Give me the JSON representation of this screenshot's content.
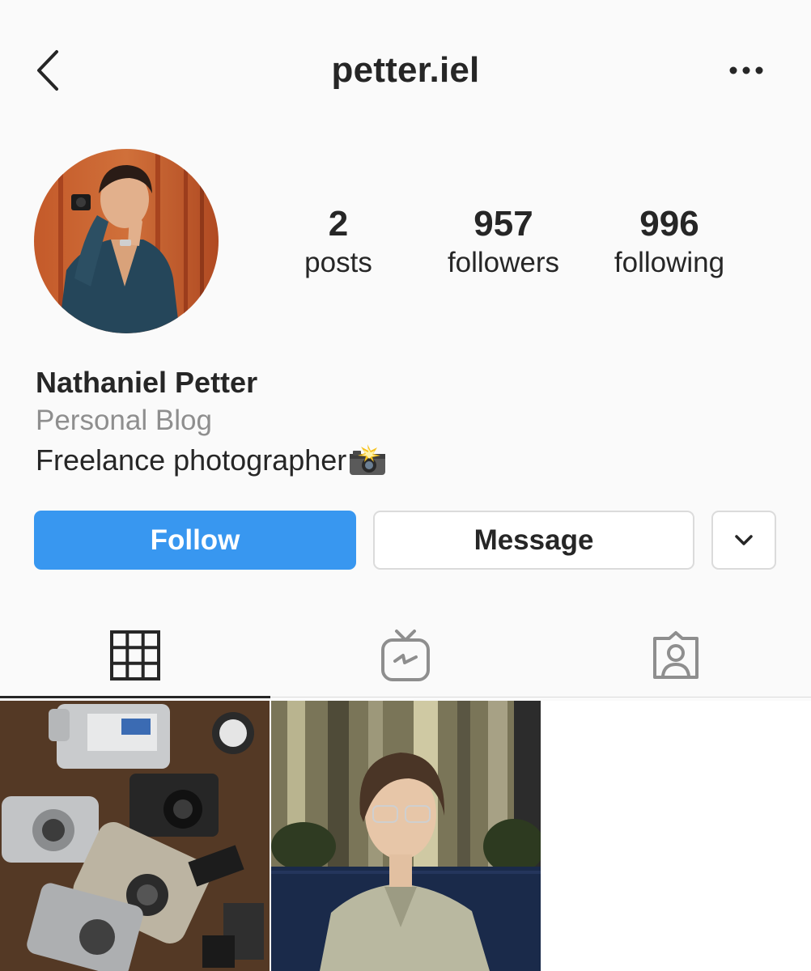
{
  "header": {
    "username": "petter.iel",
    "back_icon": "chevron-left-icon",
    "more_icon": "more-horizontal-icon"
  },
  "profile": {
    "avatar": "profile-photo",
    "stats": [
      {
        "value": "2",
        "label": "posts"
      },
      {
        "value": "957",
        "label": "followers"
      },
      {
        "value": "996",
        "label": "following"
      }
    ],
    "display_name": "Nathaniel Petter",
    "category": "Personal Blog",
    "bio": "Freelance photographer",
    "bio_emoji": "camera-with-flash-icon"
  },
  "actions": {
    "follow_label": "Follow",
    "message_label": "Message",
    "more_icon": "chevron-down-icon"
  },
  "tabs": [
    {
      "icon": "grid-icon",
      "active": true
    },
    {
      "icon": "igtv-icon",
      "active": false
    },
    {
      "icon": "tagged-icon",
      "active": false
    }
  ],
  "posts": [
    {
      "subject": "cameras-flatlay-photo"
    },
    {
      "subject": "portrait-photo"
    }
  ],
  "colors": {
    "follow_button": "#3897f0",
    "background": "#fafafa",
    "text": "#262626",
    "secondary_text": "#8e8e8e",
    "border": "#dbdbdb"
  }
}
